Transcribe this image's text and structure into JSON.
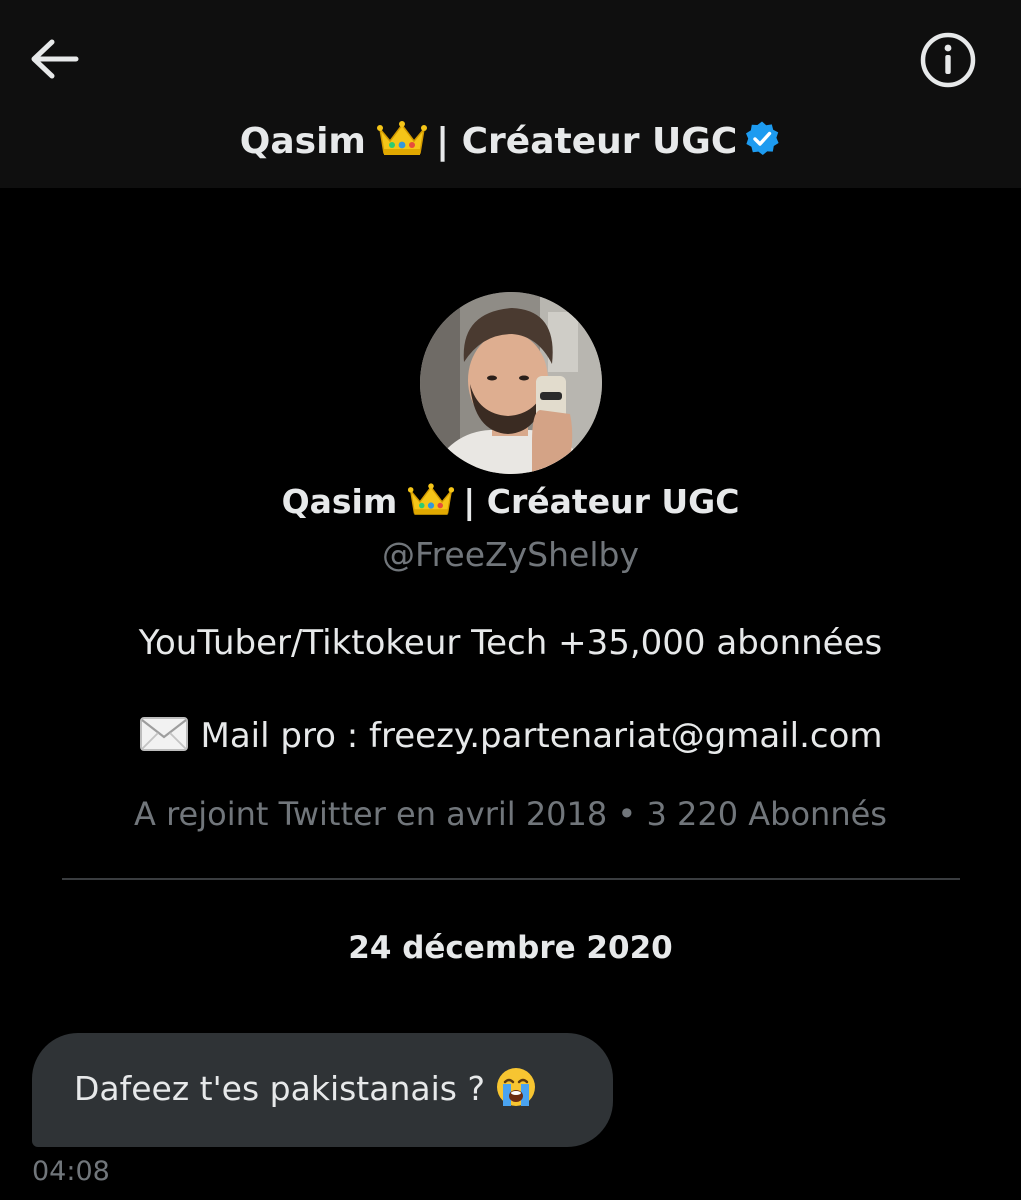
{
  "header": {
    "name": "Qasim",
    "separator_title": "| Créateur UGC",
    "back_icon": "arrow-left-icon",
    "info_icon": "info-icon",
    "verified_icon": "verified-badge-icon",
    "verified_color": "#1d9bf0"
  },
  "profile": {
    "name": "Qasim",
    "separator_title": "| Créateur UGC",
    "handle": "@FreeZyShelby",
    "bio": "YouTuber/Tiktokeur Tech +35,000 abonnées",
    "mail_line": "Mail pro : freezy.partenariat@gmail.com",
    "meta": "A rejoint Twitter en avril 2018 • 3 220 Abonnés"
  },
  "conversation": {
    "date": "24 décembre 2020",
    "messages": [
      {
        "text": "Dafeez t'es pakistanais ?",
        "emoji_icon": "loudly-crying-face-icon",
        "time": "04:08"
      }
    ]
  },
  "colors": {
    "background": "#000000",
    "topbar": "#0f0f0f",
    "primary_text": "#e7e9ea",
    "secondary_text": "#71767b",
    "bubble": "#2f3336",
    "crown": "#f5c518"
  }
}
